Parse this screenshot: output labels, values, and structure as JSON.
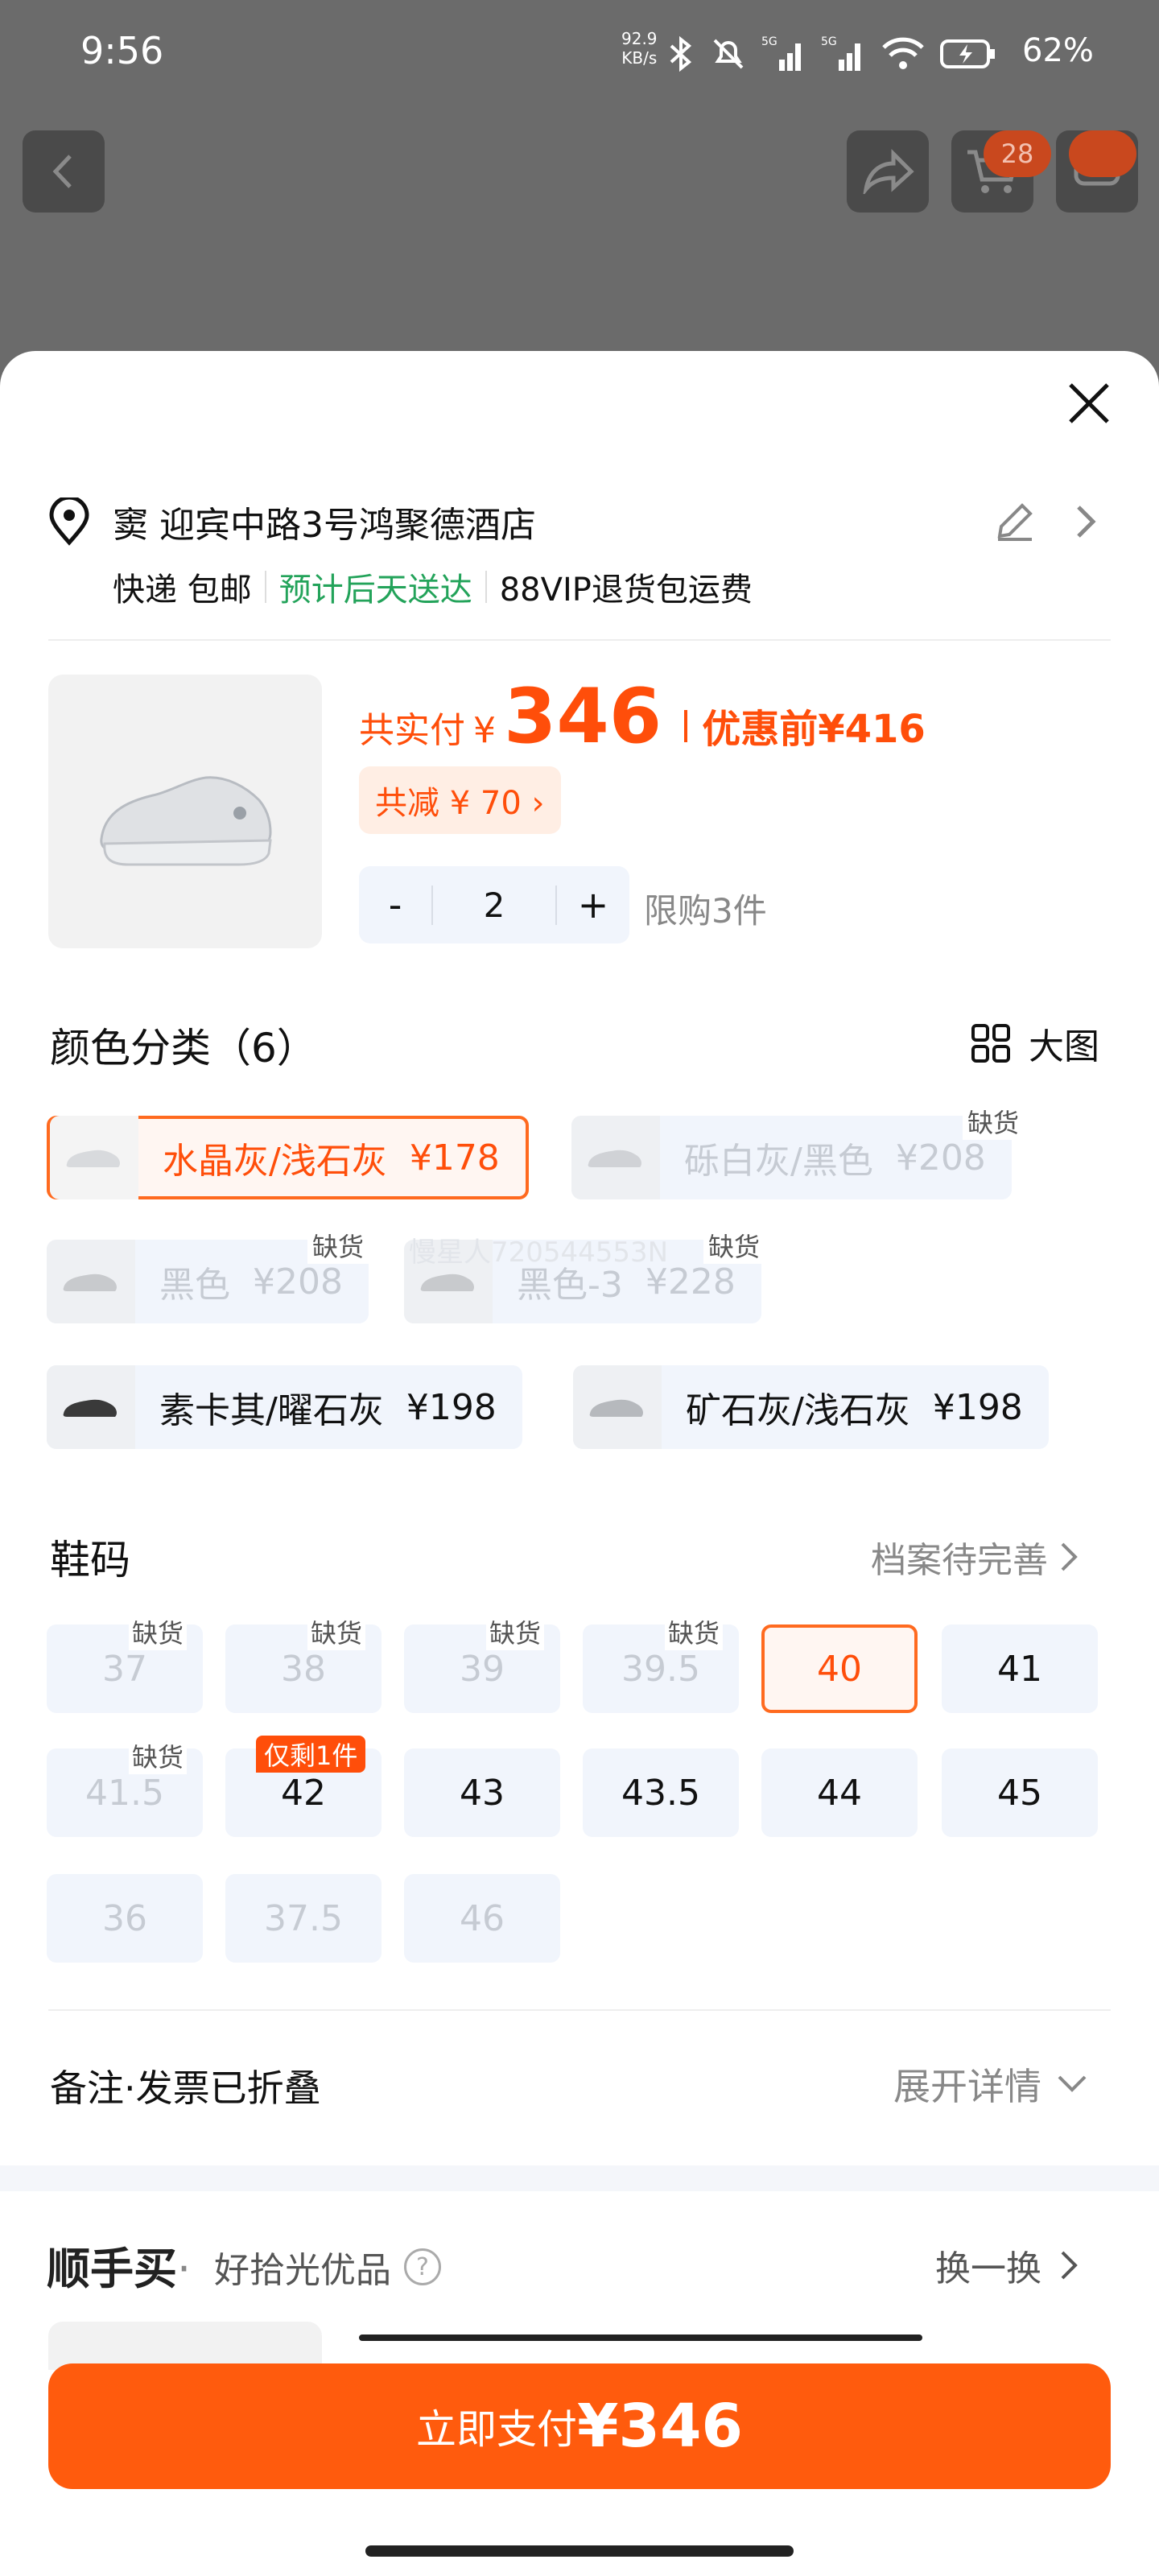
{
  "status": {
    "time": "9:56",
    "speed_top": "92.9",
    "speed_unit": "KB/s",
    "battery": "62%"
  },
  "nav": {
    "cart_count": "28"
  },
  "address": {
    "text": "窦 迎宾中路3号鸿聚德酒店",
    "ship_method": "快递 包邮",
    "eta": "预计后天送达",
    "return_info": "88VIP退货包运费"
  },
  "price": {
    "label": "共实付",
    "currency": "¥",
    "amount": "346",
    "orig_label": "优惠前",
    "orig": "¥416",
    "discount": "共减 ¥ 70 ›"
  },
  "quantity": {
    "minus": "-",
    "value": "2",
    "plus": "+",
    "limit": "限购3件"
  },
  "colors": {
    "title": "颜色分类（6）",
    "big_image": "大图",
    "out_of_stock": "缺货",
    "items": [
      {
        "name": "水晶灰/浅石灰",
        "price": "¥178"
      },
      {
        "name": "砾白灰/黑色",
        "price": "¥208"
      },
      {
        "name": "黑色",
        "price": "¥208"
      },
      {
        "name": "黑色-3",
        "price": "¥228"
      },
      {
        "name": "素卡其/曜石灰",
        "price": "¥198"
      },
      {
        "name": "矿石灰/浅石灰",
        "price": "¥198"
      }
    ]
  },
  "sizes": {
    "title": "鞋码",
    "profile": "档案待完善",
    "out_of_stock": "缺货",
    "only_one": "仅剩1件",
    "items": [
      "37",
      "38",
      "39",
      "39.5",
      "40",
      "41",
      "41.5",
      "42",
      "43",
      "43.5",
      "44",
      "45",
      "36",
      "37.5",
      "46"
    ]
  },
  "remark": {
    "label": "备注·发票已折叠",
    "expand": "展开详情"
  },
  "recommend": {
    "logo": "顺手买",
    "sub": "好拾光优品",
    "help": "?",
    "swap": "换一换"
  },
  "pay": {
    "label": "立即支付",
    "amount": "¥346"
  },
  "watermark": "慢星人720544553N",
  "colors_hex": {
    "accent": "#ff5b0d",
    "green": "#23a35a"
  }
}
